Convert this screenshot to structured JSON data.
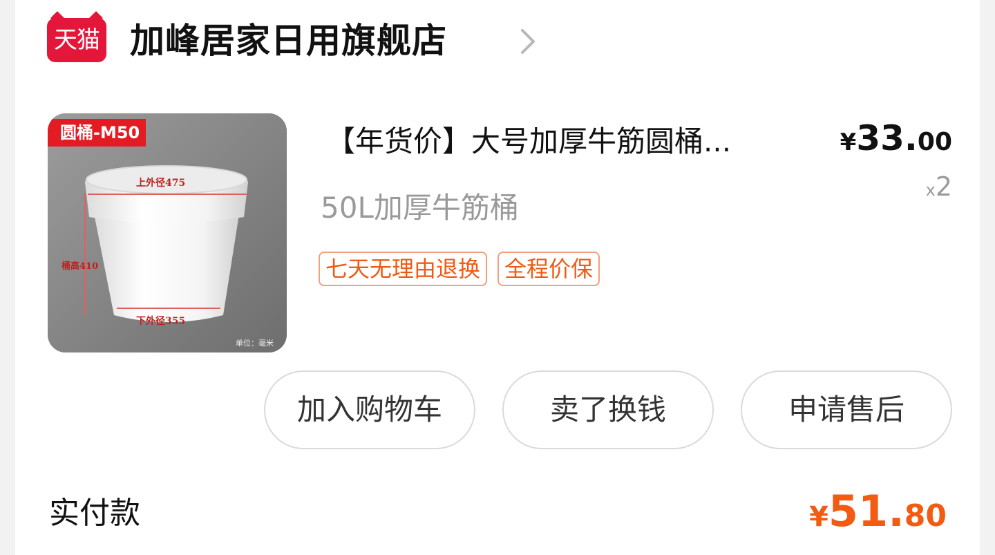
{
  "shop": {
    "logo_text": "天猫",
    "name": "加峰居家日用旗舰店"
  },
  "product": {
    "image_tag": "圆桶-M50",
    "image_labels": {
      "top": "上外径475",
      "side": "桶高410",
      "bottom": "下外径355",
      "unit": "单位：毫米"
    },
    "title": "【年货价】大号加厚牛筋圆桶...",
    "spec": "50L加厚牛筋桶",
    "price_currency": "¥",
    "price_int": "33.",
    "price_dec": "00",
    "qty_prefix": "x",
    "qty": "2",
    "tags": [
      "七天无理由退换",
      "全程价保"
    ]
  },
  "actions": {
    "add_cart": "加入购物车",
    "resell": "卖了换钱",
    "after_sale": "申请售后"
  },
  "total": {
    "label": "实付款",
    "currency": "¥",
    "int": "51.",
    "dec": "80"
  },
  "colors": {
    "tmall_red": "#e4173b",
    "price_orange": "#f35a12",
    "tag_orange": "#f05a14"
  }
}
